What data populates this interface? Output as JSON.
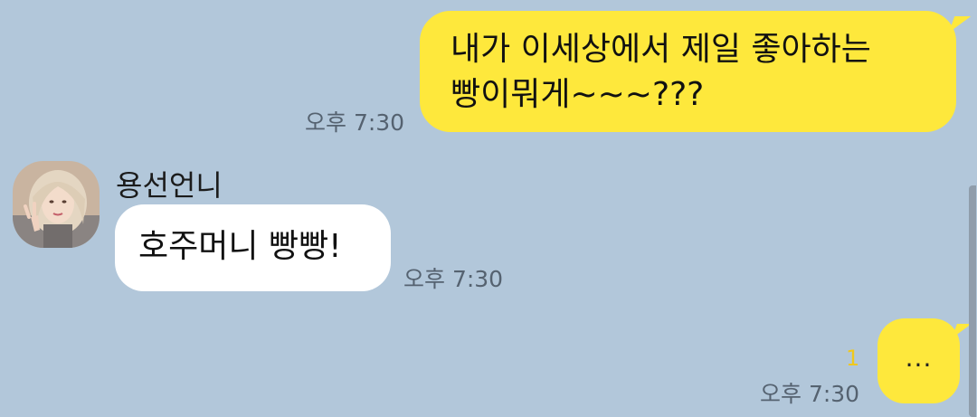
{
  "messages": [
    {
      "direction": "outgoing",
      "lines": [
        "내가 이세상에서 제일 좋아하는",
        "빵이뭐게~~~???"
      ],
      "time": "오후 7:30"
    },
    {
      "direction": "incoming",
      "sender": "용선언니",
      "avatar_icon": "profile-photo",
      "text": "호주머니 빵빵!",
      "time": "오후 7:30"
    },
    {
      "direction": "outgoing",
      "text": "...",
      "unread_count": "1",
      "time": "오후 7:30"
    }
  ],
  "colors": {
    "background": "#b2c7da",
    "outgoing_bubble": "#fee83c",
    "incoming_bubble": "#ffffff",
    "timestamp": "#556270",
    "unread_count": "#f0c81c"
  }
}
